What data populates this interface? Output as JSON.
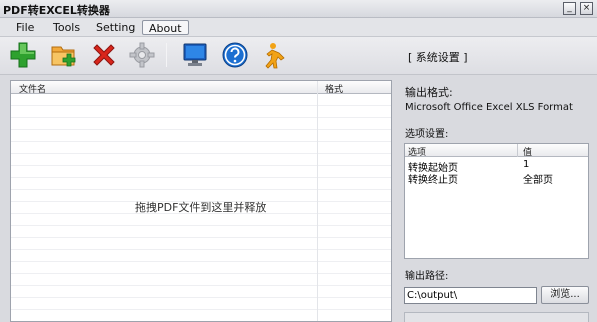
{
  "window": {
    "title": "PDF转EXCEL转换器",
    "min_glyph": "_",
    "close_glyph": "×"
  },
  "menu": [
    {
      "label": "File"
    },
    {
      "label": "Tools"
    },
    {
      "label": "Setting"
    },
    {
      "label": "About",
      "active": true
    }
  ],
  "toolbar": {
    "icons": [
      "add-icon",
      "add-folder-icon",
      "delete-icon",
      "settings-gear-icon",
      "monitor-icon",
      "help-icon",
      "run-icon"
    ],
    "system_settings": "[ 系统设置 ]"
  },
  "file_list": {
    "columns": [
      "文件名",
      "格式"
    ],
    "rows": [],
    "drop_hint": "拖拽PDF文件到这里并释放"
  },
  "output": {
    "format_label": "输出格式:",
    "format_value": "Microsoft Office Excel XLS Format",
    "options_label": "选项设置:",
    "options_columns": [
      "选项",
      "值"
    ],
    "options": [
      {
        "name": "转换起始页",
        "value": "1"
      },
      {
        "name": "转换终止页",
        "value": "全部页"
      }
    ],
    "path_label": "输出路径:",
    "path_value": "C:\\output\\",
    "browse_label": "浏览..."
  },
  "colors": {
    "accent_green": "#2ea12e",
    "delete_red": "#d9261c",
    "help_blue": "#1c6fd1"
  }
}
